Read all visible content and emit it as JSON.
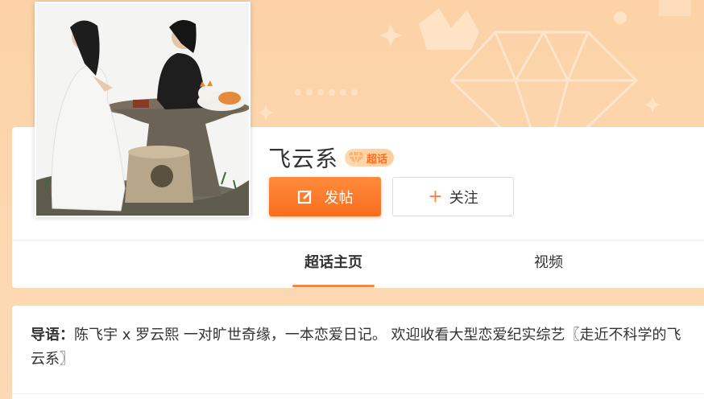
{
  "topic": {
    "name": "飞云系",
    "badge_label": "超话"
  },
  "actions": {
    "post_label": "发帖",
    "follow_label": "关注",
    "follow_prefix": "+"
  },
  "tabs": [
    {
      "label": "超话主页",
      "active": true
    },
    {
      "label": "视频",
      "active": false
    }
  ],
  "intro": {
    "lead": "导语：",
    "text": "陈飞宇 x 罗云熙 一对旷世奇缘，一本恋爱日记。 欢迎收看大型恋爱纪实综艺〖走近不科学的飞云系〗"
  },
  "colors": {
    "accent": "#ff8140",
    "banner": "#fcd2a6",
    "post_button": "#f96e1c"
  },
  "icons": {
    "post": "edit-square-icon",
    "badge": "diamond-icon"
  }
}
